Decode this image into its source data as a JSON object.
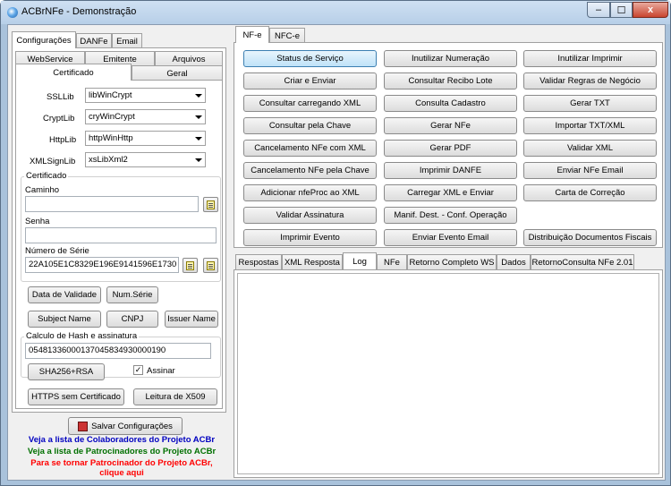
{
  "window": {
    "title": "ACBrNFe - Demonstração",
    "min": "–",
    "max": "☐",
    "close": "x"
  },
  "colors": {
    "link_blue": "#0000c0",
    "link_green": "#007000",
    "link_red": "#ff0000"
  },
  "left": {
    "tabs": [
      "Configurações",
      "DANFe",
      "Email"
    ],
    "subtabs_row1": [
      "WebService",
      "Emitente",
      "Arquivos"
    ],
    "subtabs_row2": [
      "Certificado",
      "Geral"
    ],
    "ssl_label": "SSLLib",
    "ssl_value": "libWinCrypt",
    "crypt_label": "CryptLib",
    "crypt_value": "cryWinCrypt",
    "http_label": "HttpLib",
    "http_value": "httpWinHttp",
    "xml_label": "XMLSignLib",
    "xml_value": "xsLibXml2",
    "cert_group": "Certificado",
    "caminho_label": "Caminho",
    "caminho_value": "",
    "senha_label": "Senha",
    "senha_value": "",
    "serie_label": "Número de Série",
    "serie_value": "22A105E1C8329E196E9141596E1730",
    "btn_data_validade": "Data de Validade",
    "btn_num_serie": "Num.Série",
    "btn_subject": "Subject Name",
    "btn_cnpj": "CNPJ",
    "btn_issuer": "Issuer Name",
    "hash_group": "Calculo de Hash e assinatura",
    "hash_value": "05481336000137045834930000190",
    "btn_sha": "SHA256+RSA",
    "assinar_label": "Assinar",
    "assinar_check": "✓",
    "btn_https": "HTTPS sem Certificado",
    "btn_leitura": "Leitura de X509",
    "btn_salvar": "Salvar Configurações",
    "link_colab": "Veja a lista de Colaboradores do Projeto ACBr",
    "link_patro": "Veja a lista de Patrocinadores do Projeto ACBr",
    "link_tornar1": "Para se tornar Patrocinador do Projeto ACBr,",
    "link_tornar2": "clique aqui"
  },
  "right": {
    "tabs": [
      "NF-e",
      "NFC-e"
    ],
    "buttons": [
      [
        "Status de Serviço",
        "Inutilizar Numeração",
        "Inutilizar Imprimir"
      ],
      [
        "Criar e Enviar",
        "Consultar Recibo Lote",
        "Validar Regras de Negócio"
      ],
      [
        "Consultar carregando XML",
        "Consulta Cadastro",
        "Gerar TXT"
      ],
      [
        "Consultar pela Chave",
        "Gerar NFe",
        "Importar TXT/XML"
      ],
      [
        "Cancelamento NFe com XML",
        "Gerar PDF",
        "Validar XML"
      ],
      [
        "Cancelamento NFe pela Chave",
        "Imprimir DANFE",
        "Enviar NFe Email"
      ],
      [
        "Adicionar nfeProc ao XML",
        "Carregar XML e Enviar",
        "Carta de Correção"
      ],
      [
        "Validar Assinatura",
        "Manif. Dest. - Conf. Operação",
        ""
      ],
      [
        "Imprimir Evento",
        "Enviar Evento Email",
        "Distribuição Documentos Fiscais"
      ]
    ],
    "bottom_tabs": [
      "Respostas",
      "XML Resposta",
      "Log",
      "NFe",
      "Retorno Completo WS",
      "Dados",
      "RetornoConsulta NFe 2.01"
    ]
  }
}
